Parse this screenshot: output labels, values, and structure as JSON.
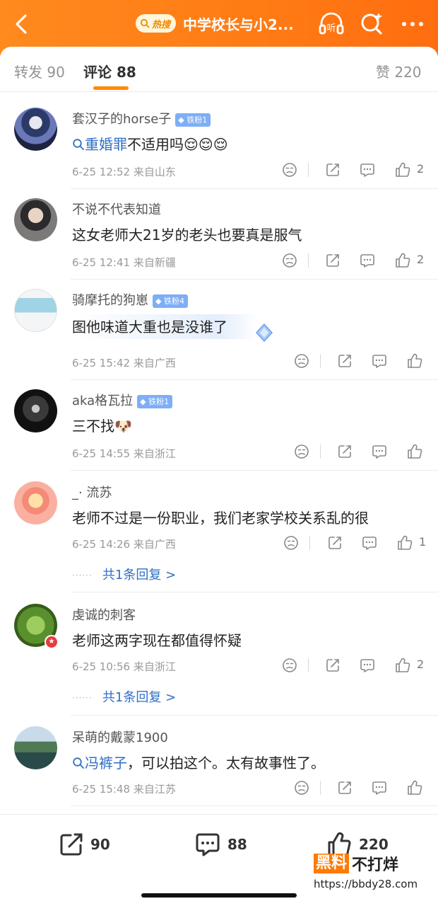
{
  "header": {
    "hot_badge": "热搜",
    "topic_title": "中学校长与小2...",
    "listen_label": "听"
  },
  "tabs": {
    "repost": "转发 90",
    "comments": "评论 88",
    "likes": "赞 220"
  },
  "comments": [
    {
      "name": "套汉子的horse子",
      "badge": "铁粉1",
      "link": "重婚罪",
      "text": "不适用吗",
      "emoji": "😌😌😌",
      "time": "6-25 12:52",
      "location": "来自山东",
      "likes": "2"
    },
    {
      "name": "不说不代表知道",
      "badge": "",
      "link": "",
      "text": "这女老师大21岁的老头也要真是服气",
      "emoji": "",
      "time": "6-25 12:41",
      "location": "来自新疆",
      "likes": "2"
    },
    {
      "name": "骑摩托的狗崽",
      "badge": "铁粉4",
      "link": "",
      "text": "图他味道大重也是没谁了",
      "emoji": "",
      "time": "6-25 15:42",
      "location": "来自广西",
      "likes": ""
    },
    {
      "name": "aka格瓦拉",
      "badge": "铁粉1",
      "link": "",
      "text": "三不找",
      "emoji": "🐶",
      "time": "6-25 14:55",
      "location": "来自浙江",
      "likes": ""
    },
    {
      "name": "_· 流苏",
      "badge": "",
      "link": "",
      "text": "老师不过是一份职业，我们老家学校关系乱的很",
      "emoji": "",
      "time": "6-25 14:26",
      "location": "来自广西",
      "likes": "1",
      "reply": "共1条回复 >"
    },
    {
      "name": "虔诚的刺客",
      "badge": "",
      "link": "",
      "text": "老师这两字现在都值得怀疑",
      "emoji": "",
      "time": "6-25 10:56",
      "location": "来自浙江",
      "likes": "2",
      "reply": "共1条回复 >"
    },
    {
      "name": "呆萌的戴蒙1900",
      "badge": "",
      "link": "冯裤子",
      "text": "，可以拍这个。太有故事性了。",
      "emoji": "",
      "time": "6-25 15:48",
      "location": "来自江苏",
      "likes": ""
    }
  ],
  "bottom": {
    "repost_count": "90",
    "comment_count": "88",
    "like_count": "220"
  },
  "watermark": {
    "brand_box": "黑料",
    "brand_text": "不打烊",
    "url": "https://bbdy28.com"
  },
  "colors": {
    "header_orange": "#ff7b14",
    "link_blue": "#2f6fc6",
    "badge_blue": "#7eaef6",
    "tab_underline": "#ff8a00"
  }
}
